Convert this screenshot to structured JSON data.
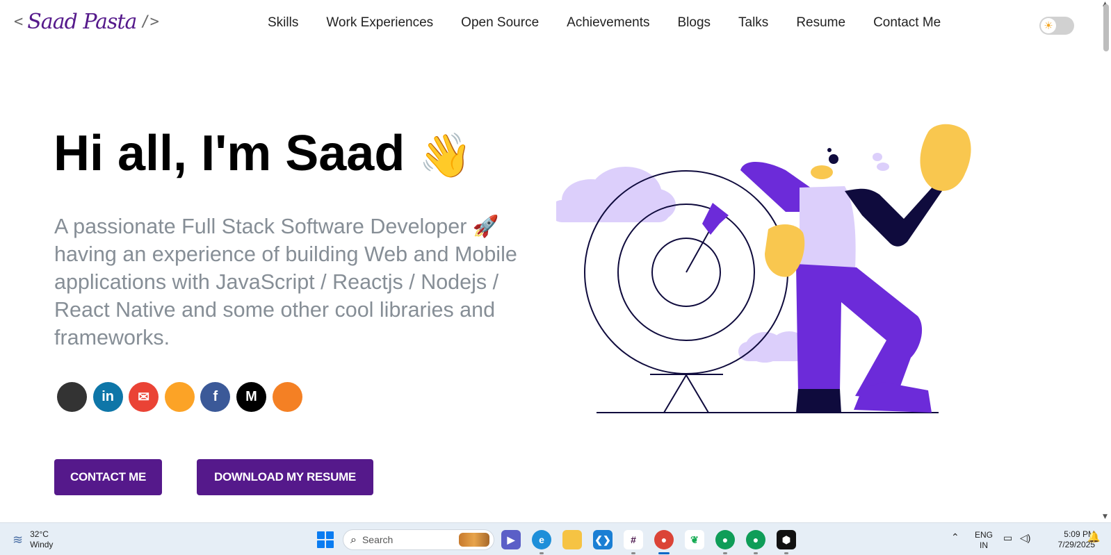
{
  "header": {
    "logo_open": "<",
    "logo_name": "Saad Pasta",
    "logo_close": "/>",
    "nav": [
      "Skills",
      "Work Experiences",
      "Open Source",
      "Achievements",
      "Blogs",
      "Talks",
      "Resume",
      "Contact Me"
    ],
    "theme_toggle_icon": "sun-icon"
  },
  "hero": {
    "greeting": "Hi all, I'm Saad",
    "greeting_emoji": "👋",
    "subtitle": "A passionate Full Stack Software Developer 🚀 having an experience of building Web and Mobile applications with JavaScript / Reactjs / Nodejs / React Native and some other cool libraries and frameworks.",
    "social": [
      {
        "name": "github-icon",
        "glyph": "",
        "color": "#333333"
      },
      {
        "name": "linkedin-icon",
        "glyph": "in",
        "color": "#0e76a8"
      },
      {
        "name": "email-icon",
        "glyph": "✉",
        "color": "#ea4335"
      },
      {
        "name": "gitlab-icon",
        "glyph": "",
        "color": "#fca326"
      },
      {
        "name": "facebook-icon",
        "glyph": "f",
        "color": "#3b5998"
      },
      {
        "name": "medium-icon",
        "glyph": "M",
        "color": "#000000"
      },
      {
        "name": "stackoverflow-icon",
        "glyph": "",
        "color": "#f48024"
      }
    ],
    "contact_button": "CONTACT ME",
    "resume_button": "DOWNLOAD MY RESUME"
  },
  "colors": {
    "accent": "#55198b",
    "subtitle": "#868e96",
    "figure_purple": "#6c2bd9",
    "figure_lavender": "#dccffb",
    "figure_yellow": "#f9c74f",
    "figure_navy": "#0f0b3d"
  },
  "taskbar": {
    "weather_temp": "32°C",
    "weather_desc": "Windy",
    "search_placeholder": "Search",
    "apps": [
      "meet-icon",
      "edge-icon",
      "file-explorer-icon",
      "vscode-icon",
      "slack-icon",
      "chrome-icon",
      "mongodb-icon",
      "chrome-profile-icon",
      "chrome-profile-icon",
      "app-icon"
    ],
    "language_line1": "ENG",
    "language_line2": "IN",
    "time": "5:09 PM",
    "date": "7/29/2025"
  }
}
